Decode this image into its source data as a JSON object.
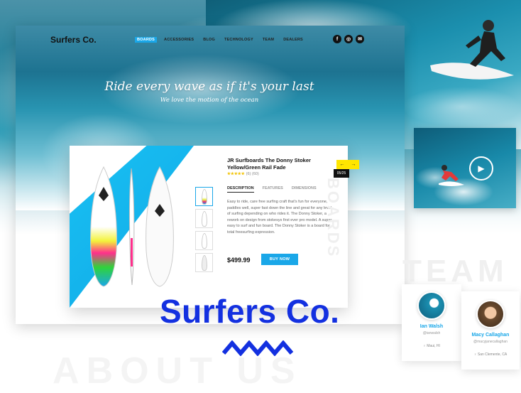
{
  "site": {
    "brand": "Surfers Co.",
    "nav": [
      "BOARDS",
      "ACCESSORIES",
      "BLOG",
      "TECHNOLOGY",
      "TEAM",
      "DEALERS"
    ],
    "nav_active": "BOARDS",
    "social": [
      "f",
      "◎",
      "✉"
    ],
    "hero_title": "Ride every wave as if it's your last",
    "hero_subtitle": "We love the motion of the ocean"
  },
  "product": {
    "title": "JR Surfboards The Donny Stoker Yellow/Green Rail Fade",
    "stars": "★★★★★",
    "reviews": "(6)  (60)",
    "tabs": [
      "DESCRIPTION",
      "FEATURES",
      "DIMENSIONS"
    ],
    "active_tab": "DESCRIPTION",
    "description": "Easy to ride, care free surfing craft that's fun for everyone, paddles well, super fast down the line and great for any level of surfing depending on who rides it. The Donny Stoker, a rework on design from stokesys first ever pro model. A super easy to surf and fun board. The Donny Stoker is a board for total freesurfing expression.",
    "price": "$499.99",
    "buy_label": "BUY NOW",
    "counter": "05/25",
    "arrow_prev": "←",
    "arrow_next": "→",
    "vertical_label": "BOARDS"
  },
  "big_brand": "Surfers Co.",
  "about_label": "ABOUT US",
  "team_label": "TEAM",
  "team": [
    {
      "name": "Ian Walsh",
      "handle": "@ianwalsh",
      "location": "♀ Maui, HI"
    },
    {
      "name": "Macy Callaghan",
      "handle": "@macyjanecallaghan",
      "location": "♀ San Clemente, CA"
    }
  ],
  "colors": {
    "accent": "#1aa7e8",
    "brand_blue": "#1330e0",
    "yellow": "#ffe600"
  }
}
